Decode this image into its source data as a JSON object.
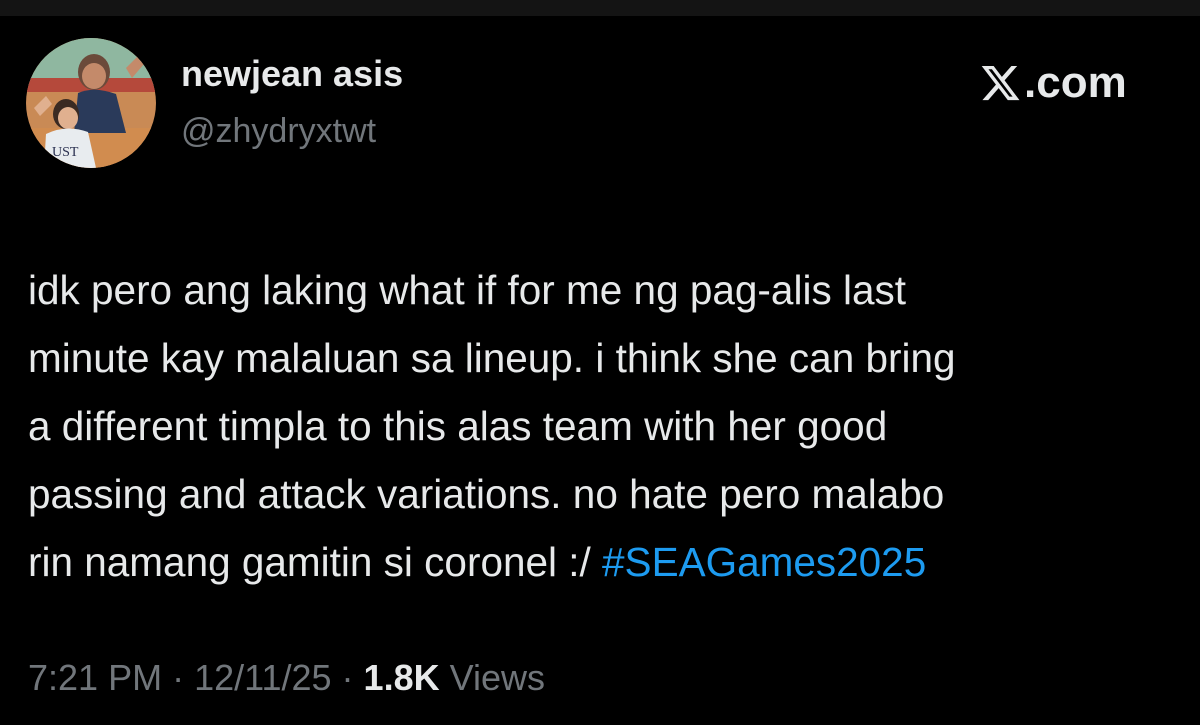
{
  "author": {
    "display_name": "newjean asis",
    "handle": "@zhydryxtwt",
    "avatar_icon": "profile-photo"
  },
  "brand": {
    "logo_icon": "x-logo-icon",
    "text": ".com"
  },
  "tweet": {
    "lines": [
      "idk pero ang laking what if for me ng pag-alis last",
      "minute kay malaluan sa lineup. i think she can bring",
      "a different timpla to this alas team with her good",
      "passing and attack variations. no hate pero malabo",
      "rin namang gamitin si coronel :/ "
    ],
    "hashtag": "#SEAGames2025",
    "hashtag_color": "#1d9bf0"
  },
  "meta": {
    "time": "7:21 PM",
    "separator": " · ",
    "date": "12/11/25",
    "views_count": "1.8K",
    "views_label": " Views"
  },
  "colors": {
    "background": "#000000",
    "text_primary": "#e7e9ea",
    "text_secondary": "#71767b"
  }
}
